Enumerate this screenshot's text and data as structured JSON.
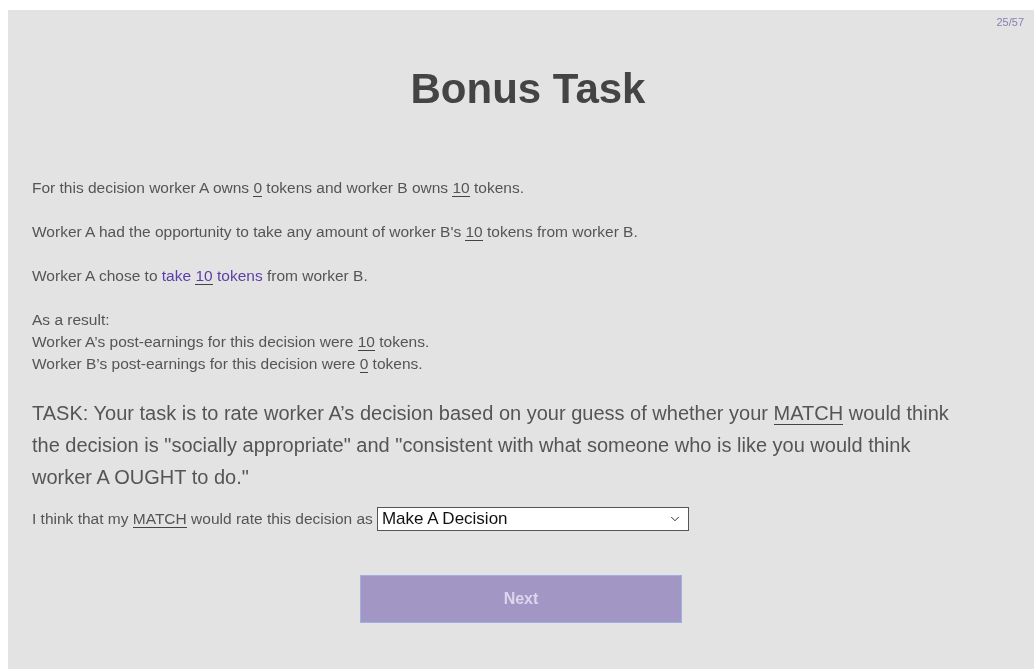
{
  "progress": "25/57",
  "title": "Bonus Task",
  "paragraphs": [
    {
      "parts": [
        {
          "text": "For this decision worker A owns ",
          "underlined": false,
          "highlighted": false
        },
        {
          "text": "0",
          "underlined": true,
          "highlighted": false
        },
        {
          "text": " tokens and worker B owns ",
          "underlined": false,
          "highlighted": false
        },
        {
          "text": "10",
          "underlined": true,
          "highlighted": false
        },
        {
          "text": " tokens.",
          "underlined": false,
          "highlighted": false
        }
      ]
    },
    {
      "parts": [
        {
          "text": "Worker A had the opportunity to take any amount of worker B's ",
          "underlined": false,
          "highlighted": false
        },
        {
          "text": "10",
          "underlined": true,
          "highlighted": false
        },
        {
          "text": " tokens from worker B.",
          "underlined": false,
          "highlighted": false
        }
      ]
    },
    {
      "parts": [
        {
          "text": "Worker A chose to ",
          "underlined": false,
          "highlighted": false
        },
        {
          "text": "take ",
          "underlined": false,
          "highlighted": true
        },
        {
          "text": "10",
          "underlined": true,
          "highlighted": true
        },
        {
          "text": " tokens",
          "underlined": false,
          "highlighted": true
        },
        {
          "text": " from worker B.",
          "underlined": false,
          "highlighted": false
        }
      ]
    }
  ],
  "result": {
    "heading": "As a result:",
    "lines": [
      {
        "parts": [
          {
            "text": "Worker A’s post-earnings for this decision were ",
            "underlined": false,
            "highlighted": false
          },
          {
            "text": "10",
            "underlined": true,
            "highlighted": false
          },
          {
            "text": " tokens.",
            "underlined": false,
            "highlighted": false
          }
        ]
      },
      {
        "parts": [
          {
            "text": "Worker B’s post-earnings for this decision were ",
            "underlined": false,
            "highlighted": false
          },
          {
            "text": "0",
            "underlined": true,
            "highlighted": false
          },
          {
            "text": " tokens.",
            "underlined": false,
            "highlighted": false
          }
        ]
      }
    ]
  },
  "task": {
    "parts": [
      {
        "text": "TASK: Your task is to rate worker A’s decision based on your guess of whether your ",
        "underlined": false,
        "highlighted": false
      },
      {
        "text": "MATCH",
        "underlined": true,
        "highlighted": false
      },
      {
        "text": " would think the decision is \"socially appropriate\" and \"consistent with what someone who is like you would think worker A OUGHT to do.\"",
        "underlined": false,
        "highlighted": false
      }
    ]
  },
  "rating": {
    "label_parts": [
      {
        "text": "I think that my ",
        "underlined": false,
        "highlighted": false
      },
      {
        "text": "MATCH",
        "underlined": true,
        "highlighted": false
      },
      {
        "text": " would rate this decision as",
        "underlined": false,
        "highlighted": false
      }
    ],
    "value": "Make A Decision"
  },
  "next_button": {
    "label": "Next",
    "disabled": true
  }
}
